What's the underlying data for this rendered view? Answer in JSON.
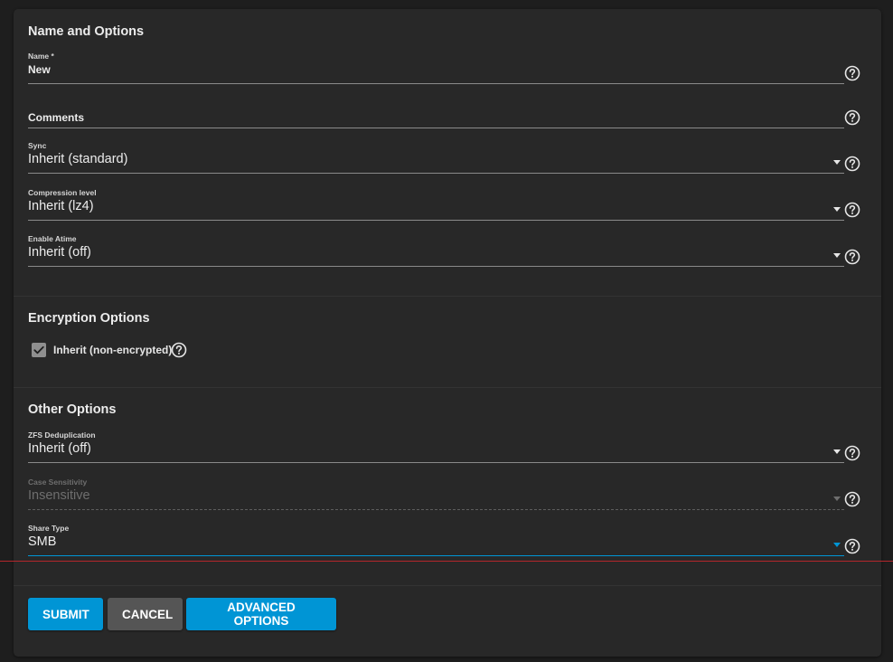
{
  "sections": {
    "name_options": "Name and Options",
    "encryption": "Encryption Options",
    "other": "Other Options"
  },
  "fields": {
    "name": {
      "label": "Name *",
      "value": "New"
    },
    "comments": {
      "label": "",
      "value": "Comments"
    },
    "sync": {
      "label": "Sync",
      "value": "Inherit (standard)"
    },
    "compression": {
      "label": "Compression level",
      "value": "Inherit (lz4)"
    },
    "atime": {
      "label": "Enable Atime",
      "value": "Inherit (off)"
    },
    "dedup": {
      "label": "ZFS Deduplication",
      "value": "Inherit (off)"
    },
    "case": {
      "label": "Case Sensitivity",
      "value": "Insensitive"
    },
    "share_type": {
      "label": "Share Type",
      "value": "SMB"
    }
  },
  "encryption": {
    "inherit_label": "Inherit (non-encrypted)",
    "inherit_checked": true
  },
  "buttons": {
    "submit": "Submit",
    "cancel": "Cancel",
    "advanced": "Advanced Options"
  },
  "colors": {
    "background": "#1e1e1e",
    "card": "#282828",
    "primary": "#0095d5",
    "secondary": "#555555",
    "text": "#e6e6e6",
    "disabled": "#6e6e6e"
  },
  "icons": {
    "help": "help-circle-icon",
    "dropdown": "caret-down-icon",
    "check": "check-icon"
  }
}
